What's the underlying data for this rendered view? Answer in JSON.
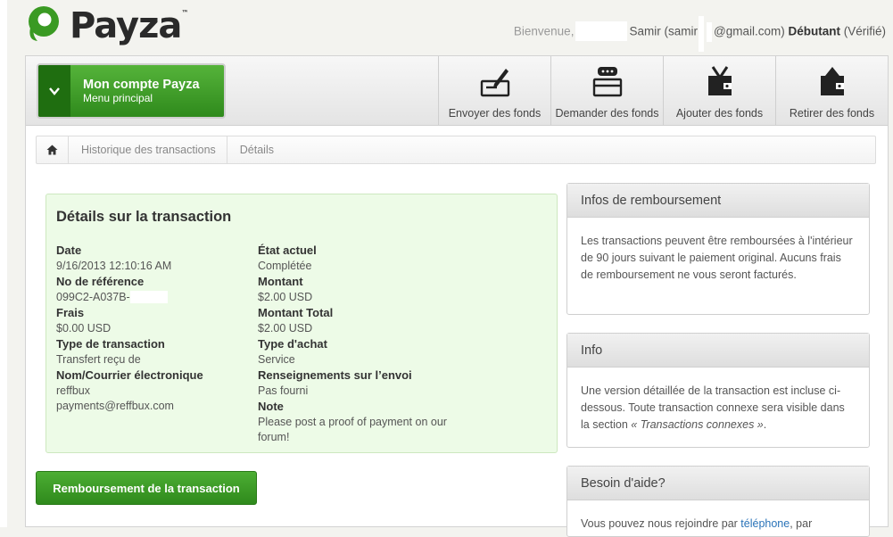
{
  "header": {
    "logo_text": "Payza",
    "logo_tm": "™",
    "welcome_prefix": "Bienvenue,",
    "user_name": "Samir",
    "user_email_prefix": "(samir",
    "user_email_domain": "@gmail.com)",
    "level": "Débutant",
    "status": "(Vérifié)"
  },
  "nav": {
    "account_title": "Mon compte Payza",
    "account_subtitle": "Menu principal",
    "items": [
      {
        "label": "Envoyer des fonds",
        "icon": "send-funds-icon"
      },
      {
        "label": "Demander des fonds",
        "icon": "request-funds-icon"
      },
      {
        "label": "Ajouter des fonds",
        "icon": "add-funds-icon"
      },
      {
        "label": "Retirer des fonds",
        "icon": "withdraw-funds-icon"
      }
    ]
  },
  "breadcrumb": {
    "items": [
      "Historique des transactions",
      "Détails"
    ]
  },
  "transaction": {
    "title": "Détails sur la transaction",
    "date_label": "Date",
    "date_value": "9/16/2013 12:10:16 AM",
    "ref_label": "No de référence",
    "ref_value": "099C2-A037B-",
    "fees_label": "Frais",
    "fees_value": "$0.00 USD",
    "type_label": "Type de transaction",
    "type_value": "Transfert reçu de",
    "name_label": "Nom/Courrier électronique",
    "name_value": "reffbux",
    "email_value": "payments@reffbux.com",
    "state_label": "État actuel",
    "state_value": "Complétée",
    "amount_label": "Montant",
    "amount_value": "$2.00 USD",
    "total_label": "Montant Total",
    "total_value": "$2.00 USD",
    "purchase_label": "Type d'achat",
    "purchase_value": "Service",
    "shipping_label": "Renseignements sur l’envoi",
    "shipping_value": "Pas fourni",
    "note_label": "Note",
    "note_value": "Please post a proof of payment on our forum!"
  },
  "refund_button": "Remboursement de la transaction",
  "panels": {
    "refund_info": {
      "title": "Infos de remboursement",
      "body": "Les transactions peuvent être remboursées à l'intérieur de 90 jours suivant le paiement original. Aucuns frais de remboursement ne vous seront facturés."
    },
    "info": {
      "title": "Info",
      "body_prefix": "Une version détaillée de la transaction est incluse ci-dessous. Toute transaction connexe sera visible dans la section ",
      "body_em": "« Transactions connexes »",
      "body_suffix": "."
    },
    "help": {
      "title": "Besoin d'aide?",
      "body_prefix": "Vous pouvez nous rejoindre par ",
      "body_link": "téléphone",
      "body_suffix": ", par"
    }
  },
  "colors": {
    "brand_green": "#3a9a23",
    "link_blue": "#2a73b8"
  }
}
